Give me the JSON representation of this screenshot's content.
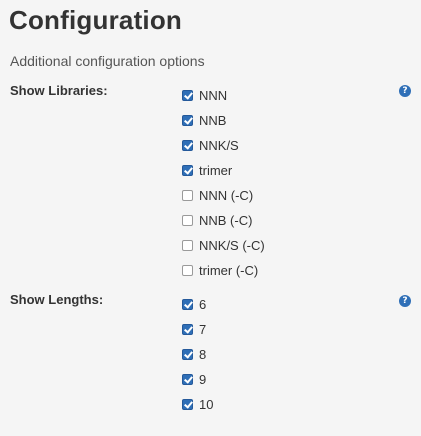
{
  "header": {
    "title": "Configuration",
    "subtitle": "Additional configuration options"
  },
  "libraries": {
    "label": "Show Libraries:",
    "help_icon": "question-circle-icon",
    "options": [
      {
        "label": "NNN",
        "checked": true
      },
      {
        "label": "NNB",
        "checked": true
      },
      {
        "label": "NNK/S",
        "checked": true
      },
      {
        "label": "trimer",
        "checked": true
      },
      {
        "label": "NNN (-C)",
        "checked": false
      },
      {
        "label": "NNB (-C)",
        "checked": false
      },
      {
        "label": "NNK/S (-C)",
        "checked": false
      },
      {
        "label": "trimer (-C)",
        "checked": false
      }
    ]
  },
  "lengths": {
    "label": "Show Lengths:",
    "help_icon": "question-circle-icon",
    "options": [
      {
        "label": "6",
        "checked": true
      },
      {
        "label": "7",
        "checked": true
      },
      {
        "label": "8",
        "checked": true
      },
      {
        "label": "9",
        "checked": true
      },
      {
        "label": "10",
        "checked": true
      }
    ]
  },
  "colors": {
    "accent": "#2f6fb7",
    "background": "#f5f5f5",
    "text": "#333333"
  }
}
